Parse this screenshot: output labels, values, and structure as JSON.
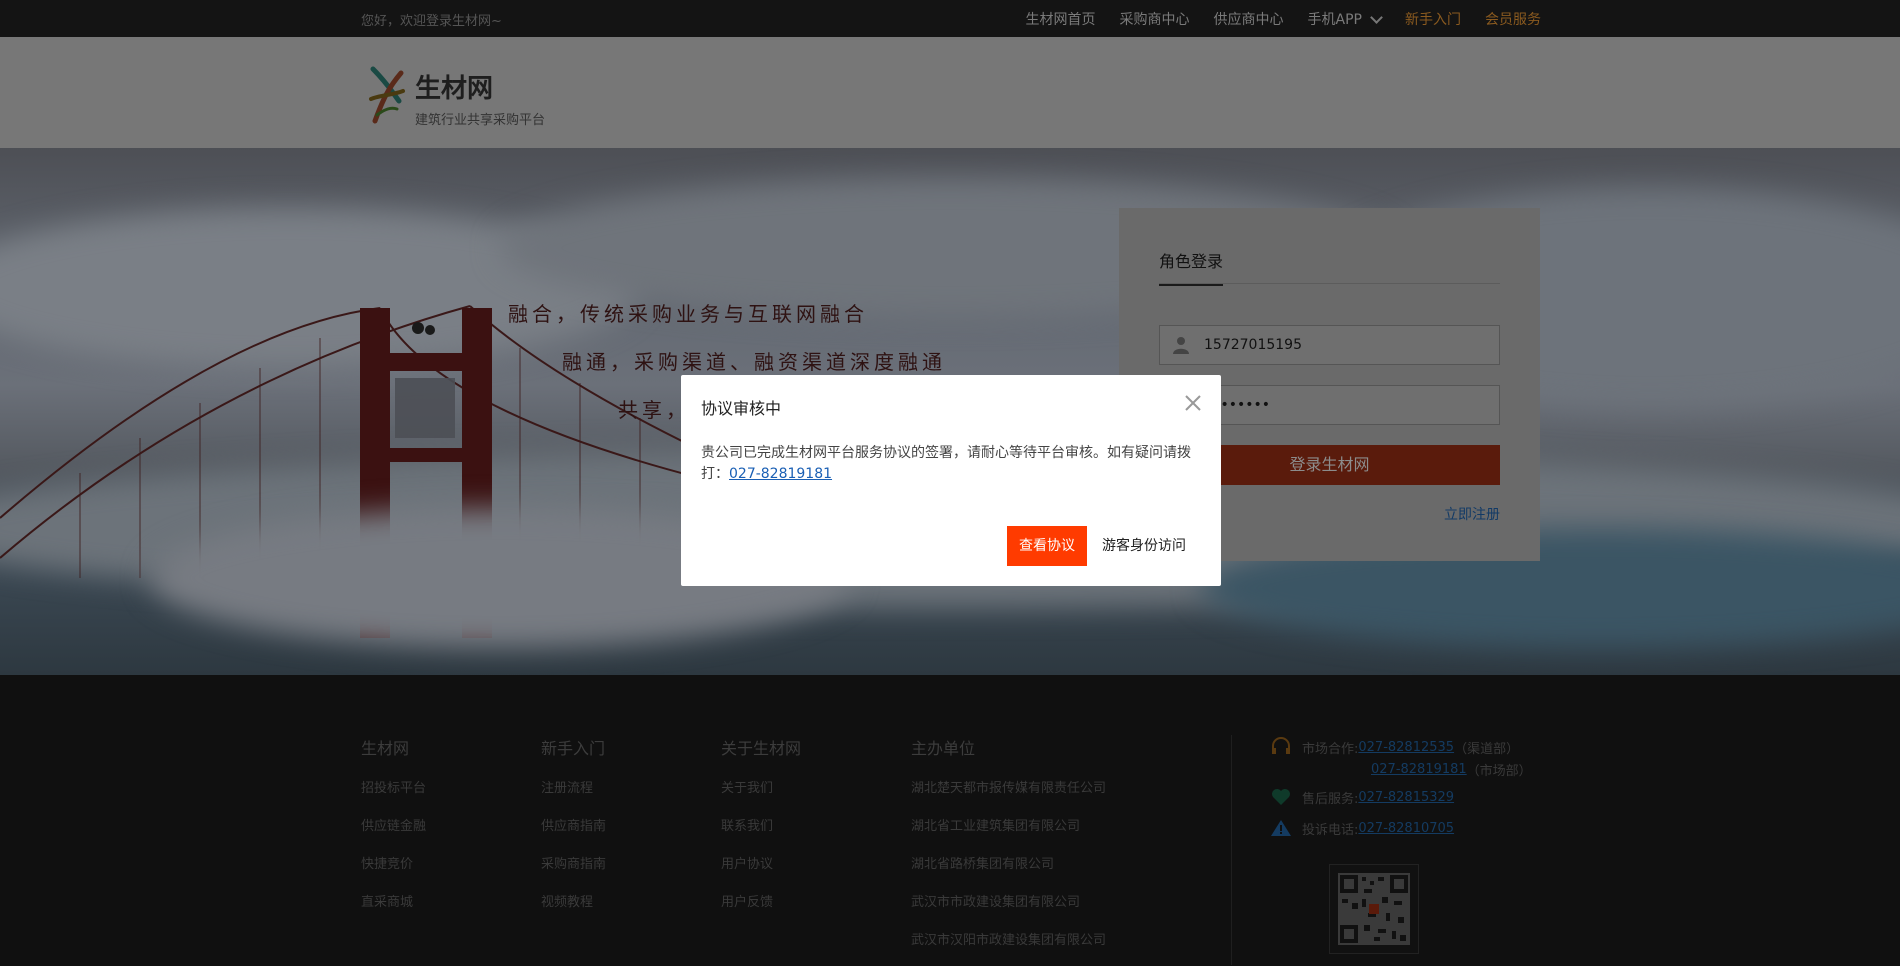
{
  "topbar": {
    "welcome": "您好，欢迎登录生材网~",
    "nav": [
      {
        "label": "生材网首页"
      },
      {
        "label": "采购商中心"
      },
      {
        "label": "供应商中心"
      },
      {
        "label": "手机APP"
      },
      {
        "label": "新手入门"
      },
      {
        "label": "会员服务"
      }
    ]
  },
  "header": {
    "logo_title": "生材网",
    "logo_subtitle": "建筑行业共享采购平台"
  },
  "hero": {
    "slogans": [
      "融合，传统采购业务与互联网融合",
      "融通，采购渠道、融资渠道深度融通",
      "共享，"
    ]
  },
  "login": {
    "tab": "角色登录",
    "phone_value": "15727015195",
    "password_mask": "••••••••",
    "submit_label": "登录生材网",
    "register_label": "立即注册"
  },
  "footer": {
    "columns": [
      {
        "heading": "生材网",
        "items": [
          "招投标平台",
          "供应链金融",
          "快捷竞价",
          "直采商城"
        ]
      },
      {
        "heading": "新手入门",
        "items": [
          "注册流程",
          "供应商指南",
          "采购商指南",
          "视频教程"
        ]
      },
      {
        "heading": "关于生材网",
        "items": [
          "关于我们",
          "联系我们",
          "用户协议",
          "用户反馈"
        ]
      },
      {
        "heading": "主办单位",
        "items": [
          "湖北楚天都市报传媒有限责任公司",
          "湖北省工业建筑集团有限公司",
          "湖北省路桥集团有限公司",
          "武汉市市政建设集团有限公司",
          "武汉市汉阳市政建设集团有限公司"
        ]
      }
    ],
    "contact": {
      "market_label": "市场合作:",
      "market_phone_1": "027-82812535",
      "market_note_1": "（渠道部）",
      "market_phone_2": "027-82819181",
      "market_note_2": "（市场部）",
      "service_label": "售后服务:",
      "service_phone": "027-82815329",
      "complaint_label": "投诉电话:",
      "complaint_phone": "027-82810705"
    }
  },
  "modal": {
    "title": "协议审核中",
    "body": "贵公司已完成生材网平台服务协议的签署，请耐心等待平台审核。如有疑问请拨打：",
    "phone": "027-82819181",
    "primary_label": "查看协议",
    "secondary_label": "游客身份访问"
  },
  "colors": {
    "accent": "#ff3b00",
    "link": "#1a5fb4"
  }
}
